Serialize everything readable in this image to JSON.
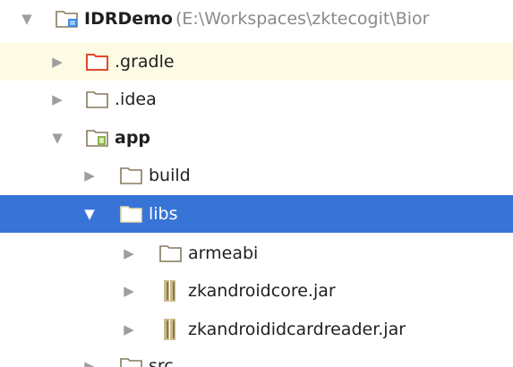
{
  "project_tree": {
    "root": {
      "name": "IDRDemo",
      "path": "(E:\\Workspaces\\zktecogit\\Bior"
    },
    "gradle": {
      "name": ".gradle"
    },
    "idea": {
      "name": ".idea"
    },
    "app": {
      "name": "app"
    },
    "build": {
      "name": "build"
    },
    "libs": {
      "name": "libs"
    },
    "armeabi": {
      "name": "armeabi"
    },
    "jar1": {
      "name": "zkandroidcore.jar"
    },
    "jar2": {
      "name": "zkandroididcardreader.jar"
    },
    "src": {
      "name": "src"
    }
  },
  "colors": {
    "selection": "#3874d8",
    "hover_highlight": "#fdfbe3",
    "folder_orange": "#e24a27",
    "folder_brown": "#85795d",
    "module_blue": "#3d8be8"
  },
  "icons": {
    "expanded": "▼",
    "collapsed": "▶"
  }
}
